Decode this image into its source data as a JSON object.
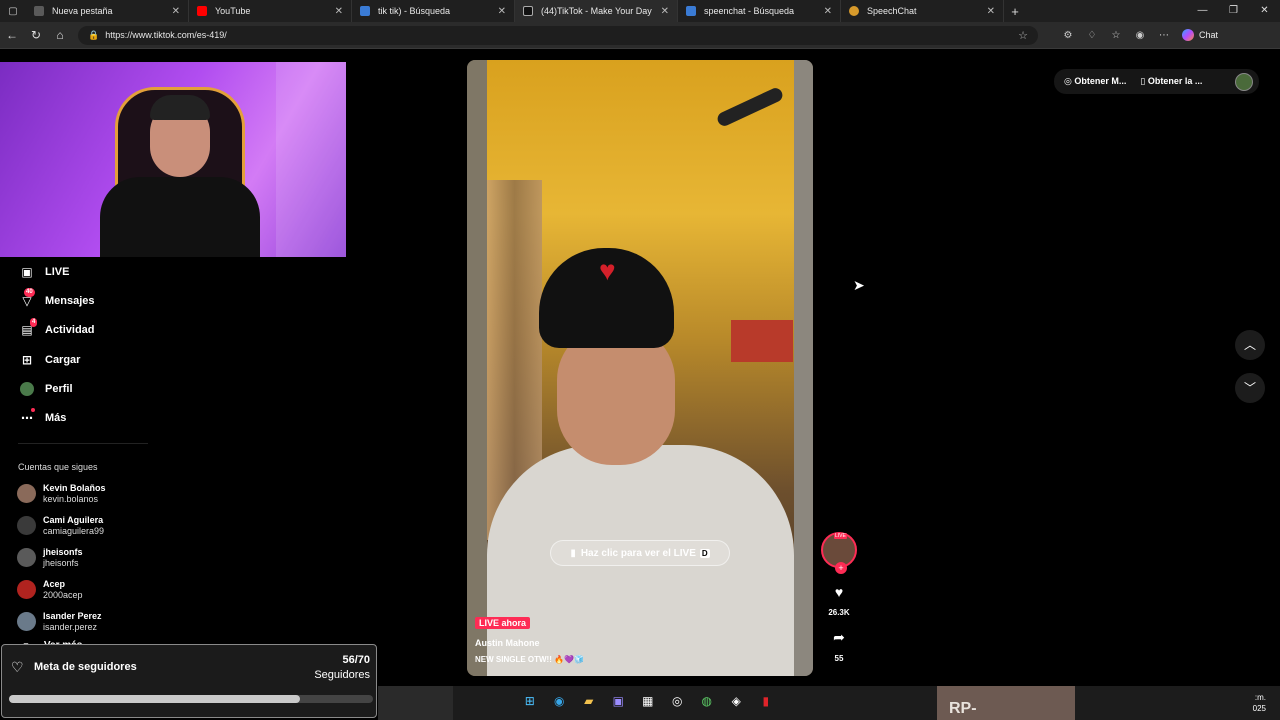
{
  "browser": {
    "tabs": [
      {
        "title": "Nueva pestaña",
        "color": "#5a5a5a"
      },
      {
        "title": "YouTube",
        "color": "#ff0000"
      },
      {
        "title": "tik tik) - Búsqueda",
        "color": "#3a7bd5"
      },
      {
        "title": "(44)TikTok - Make Your Day",
        "color": "#111111"
      },
      {
        "title": "speenchat - Búsqueda",
        "color": "#3a7bd5"
      },
      {
        "title": "SpeechChat",
        "color": "#d79a2b"
      }
    ],
    "url": "https://www.tiktok.com/es-419/",
    "copilot_label": "Chat"
  },
  "sidebar": {
    "items": [
      {
        "label": "LIVE",
        "icon": "live-icon"
      },
      {
        "label": "Mensajes",
        "icon": "messages-icon",
        "badge": "40"
      },
      {
        "label": "Actividad",
        "icon": "activity-icon",
        "badge": "4"
      },
      {
        "label": "Cargar",
        "icon": "upload-icon"
      },
      {
        "label": "Perfil",
        "icon": "profile-icon"
      },
      {
        "label": "Más",
        "icon": "more-icon"
      }
    ],
    "following_title": "Cuentas que sigues",
    "following": [
      {
        "name": "Kevin Bolaños",
        "handle": "kevin.bolanos",
        "color": "#8a6a5a"
      },
      {
        "name": "Cami Aguilera",
        "handle": "camiaguilera99",
        "color": "#3a3a3a"
      },
      {
        "name": "jheisonfs",
        "handle": "jheisonfs",
        "color": "#5a5a5a"
      },
      {
        "name": "Acep",
        "handle": "2000acep",
        "color": "#b0231f"
      },
      {
        "name": "Isander Perez",
        "handle": "isander.perez",
        "color": "#6a7a8a"
      }
    ],
    "see_more": "Ver más"
  },
  "goal": {
    "label": "Meta de seguidores",
    "count": "56/70",
    "unit": "Seguidores",
    "progress": 0.8
  },
  "video": {
    "cta": "Haz clic para ver el LIVE",
    "cta_key": "D",
    "live_badge": "LIVE ahora",
    "author": "Austin Mahone",
    "caption": "NEW SINGLE OTW!! 🔥💜🧊"
  },
  "actions": {
    "avatar_live": "LIVE",
    "likes": "26.3K",
    "shares": "55"
  },
  "top_buttons": {
    "btn1": "Obtener M...",
    "btn2": "Obtener la ..."
  },
  "taskbar": {
    "thumb_text": "RP-CUARTETOS",
    "time": ":m.",
    "date": "025"
  }
}
